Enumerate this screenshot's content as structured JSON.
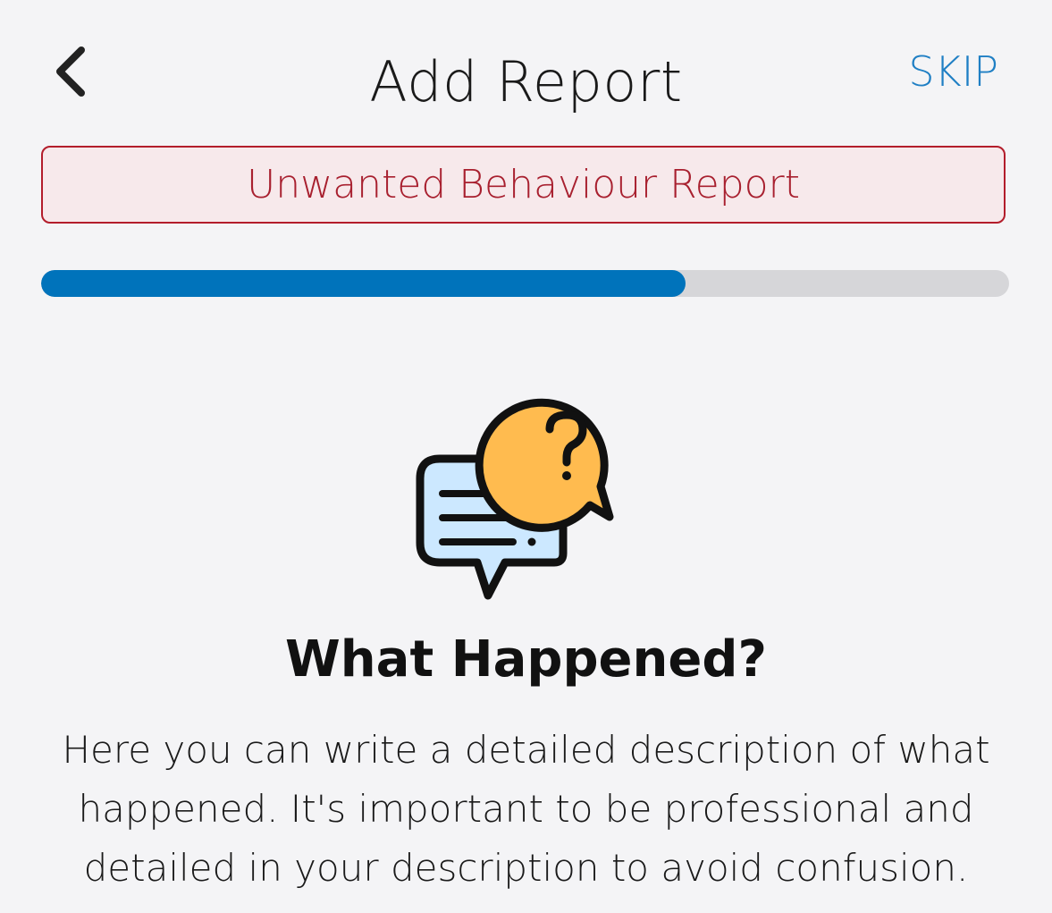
{
  "header": {
    "title": "Add Report",
    "back_icon": "chevron-left-icon",
    "skip_label": "SKIP"
  },
  "report_type": {
    "label": "Unwanted Behaviour Report",
    "border_color": "#b31d2b",
    "background_color": "#f7e9eb",
    "text_color": "#a8202f"
  },
  "progress": {
    "value": 0.666,
    "fill_color": "#0073bb",
    "track_color": "#d6d6d9"
  },
  "illustration": {
    "icon": "chat-question-bubbles-icon",
    "colors": {
      "message_bubble": "#cce8ff",
      "question_bubble": "#ffbb4f",
      "outline": "#111111"
    }
  },
  "content": {
    "heading": "What Happened?",
    "description": "Here you can write a detailed description of what happened. It's important to be professional and detailed in your description to avoid confusion."
  },
  "theme": {
    "background": "#f4f4f6",
    "accent": "#1f7fc4"
  }
}
